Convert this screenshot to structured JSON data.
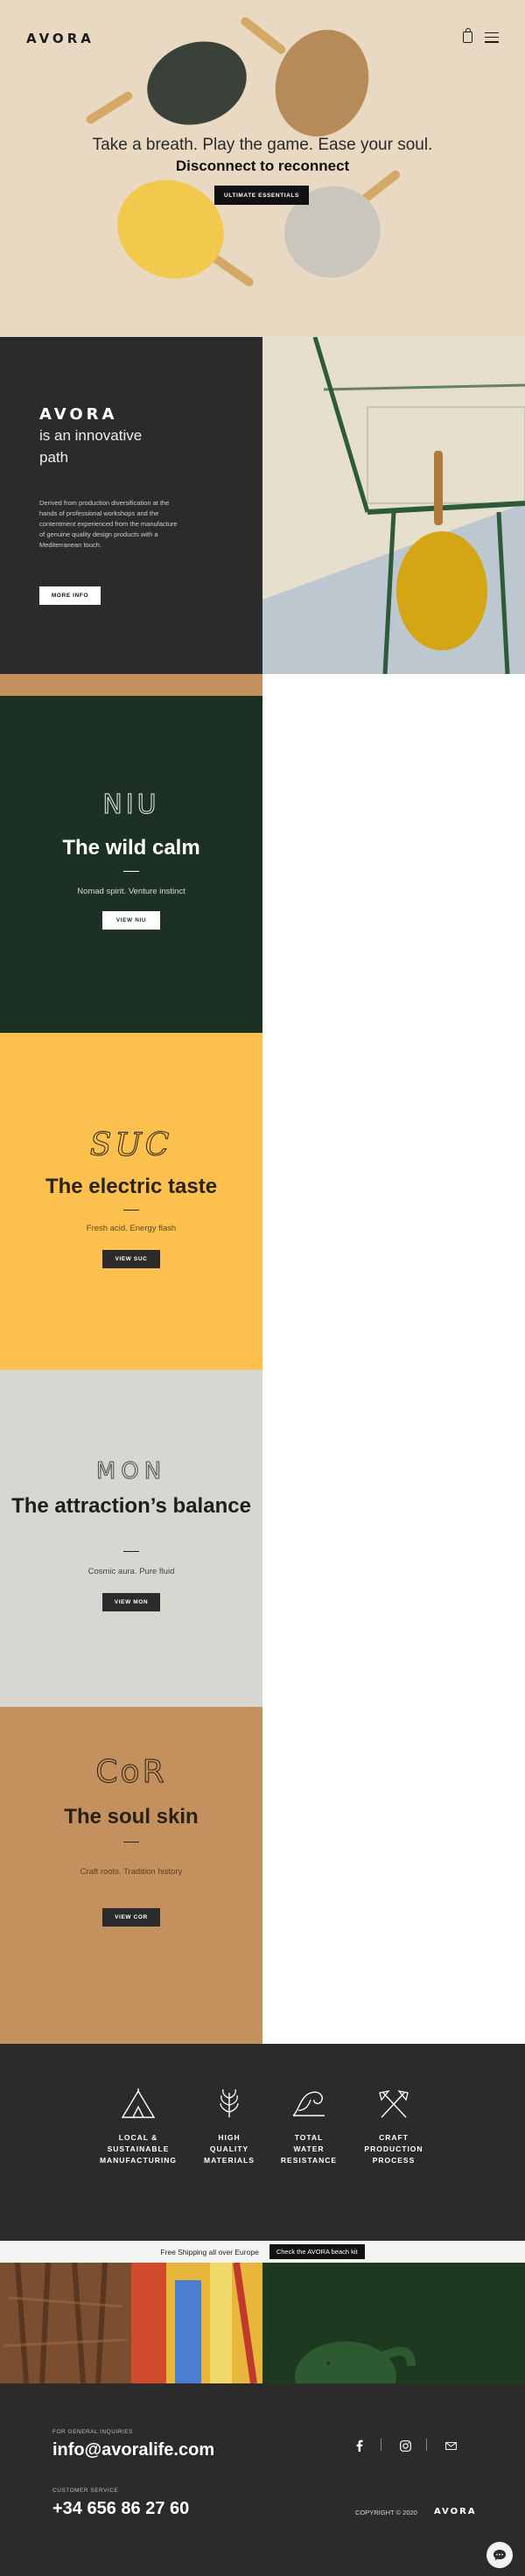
{
  "header": {
    "logo": "AVORA",
    "icons": [
      "bag-icon",
      "menu-icon"
    ]
  },
  "hero": {
    "tagline": "Take a breath. Play the game. Ease your soul.",
    "title": "Disconnect to reconnect",
    "button_label": "ULTIMATE ESSENTIALS"
  },
  "about": {
    "logo": "AVORA",
    "subtitle": "is an innovative path",
    "text": "Derived from production diversification at the hands of professional workshops and the contentment experienced from the manufacture of genuine quality design products with a Mediterranean touch.",
    "button_label": "MORE INFO"
  },
  "products": [
    {
      "logo": "NIU",
      "title": "The wild calm",
      "subtitle": "Nomad spirit. Venture instinct",
      "button_label": "VIEW NIU",
      "color": "#1c3024"
    },
    {
      "logo": "SUC",
      "title": "The electric taste",
      "subtitle": "Fresh acid. Energy flash",
      "button_label": "VIEW SUC",
      "color": "#fbc04e"
    },
    {
      "logo": "MON",
      "title": "The attraction’s balance",
      "subtitle": "Cosmic aura. Pure fluid",
      "button_label": "VIEW MON",
      "color": "#d8d6d1"
    },
    {
      "logo": "CoR",
      "title": "The soul skin",
      "subtitle": "Craft roots. Tradition history",
      "button_label": "VIEW COR",
      "color": "#c4915e"
    }
  ],
  "features": [
    {
      "icon": "tent-mountain-icon",
      "label_lines": [
        "LOCAL &",
        "SUSTAINABLE",
        "MANUFACTURING"
      ]
    },
    {
      "icon": "wheat-icon",
      "label_lines": [
        "HIGH",
        "QUALITY",
        "MATERIALS"
      ]
    },
    {
      "icon": "wave-icon",
      "label_lines": [
        "TOTAL",
        "WATER",
        "RESISTANCE"
      ]
    },
    {
      "icon": "crossed-axes-icon",
      "label_lines": [
        "CRAFT",
        "PRODUCTION",
        "PROCESS"
      ]
    }
  ],
  "promo": {
    "text": "Free Shipping all over Europe",
    "button_label": "Check the AVORA beach kit"
  },
  "footer": {
    "general_label": "FOR GENERAL INQUIRIES",
    "email": "info@avoralife.com",
    "service_label": "CUSTOMER SERVICE",
    "phone": "+34 656 86 27 60",
    "copyright": "COPYRIGHT © 2020",
    "logo": "AVORA",
    "social_icons": [
      "facebook-icon",
      "instagram-icon",
      "mail-icon"
    ]
  }
}
